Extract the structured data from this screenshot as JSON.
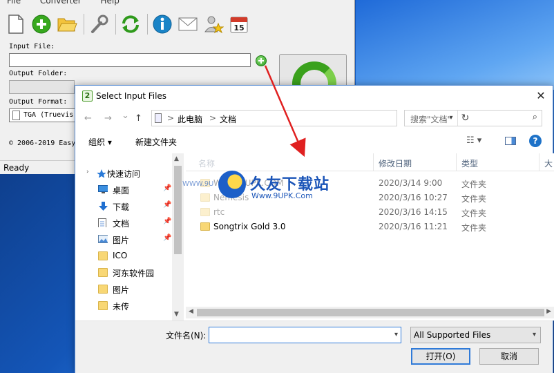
{
  "app": {
    "menu": [
      "File",
      "Converter",
      "Help"
    ],
    "labels": {
      "input_file": "Input File:",
      "output_folder": "Output Folder:",
      "output_format": "Output Format:"
    },
    "output_format_value": "TGA (Truevis",
    "copyright": "© 2006-2019 Easy",
    "status": "Ready",
    "toolbar_icons": [
      "new-file-icon",
      "add-icon",
      "open-folder-icon",
      "settings-wrench-icon",
      "convert-refresh-icon",
      "info-icon",
      "mail-icon",
      "user-star-icon",
      "calendar-icon"
    ],
    "calendar_day": "15"
  },
  "dialog": {
    "title": "Select Input Files",
    "title_icon_text": "2",
    "close": "✕",
    "nav": {
      "back": "←",
      "forward": "→",
      "dropdown": "⌄",
      "up": "↑"
    },
    "breadcrumbs": [
      "此电脑",
      "文档"
    ],
    "breadcrumb_sep": ">",
    "refresh": "↻",
    "search_placeholder": "搜索\"文档\"",
    "search_icon": "⌕",
    "commands": {
      "organize": "组织 ▾",
      "new_folder": "新建文件夹"
    },
    "view_icon": "☷ ▾",
    "help": "?",
    "nav_items": [
      {
        "label": "快速访问",
        "icon": "star-icon",
        "pinned": false
      },
      {
        "label": "桌面",
        "icon": "desktop-icon",
        "pinned": true
      },
      {
        "label": "下载",
        "icon": "download-icon",
        "pinned": true
      },
      {
        "label": "文档",
        "icon": "document-icon",
        "pinned": true
      },
      {
        "label": "图片",
        "icon": "picture-icon",
        "pinned": true
      },
      {
        "label": "ICO",
        "icon": "folder-icon",
        "pinned": false
      },
      {
        "label": "河东软件园",
        "icon": "folder-icon",
        "pinned": false
      },
      {
        "label": "图片",
        "icon": "folder-icon",
        "pinned": false
      },
      {
        "label": "未传",
        "icon": "folder-icon",
        "pinned": false
      }
    ],
    "columns": {
      "name": "名称",
      "date": "修改日期",
      "type": "类型",
      "size": "大"
    },
    "files": [
      {
        "name": "WWW.9UPK.COM",
        "date": "2020/3/14 9:00",
        "type": "文件夹",
        "faded": true
      },
      {
        "name": "Nemesis",
        "date": "2020/3/16 10:27",
        "type": "文件夹",
        "faded": true
      },
      {
        "name": "rtc",
        "date": "2020/3/16 14:15",
        "type": "文件夹",
        "faded": true
      },
      {
        "name": "Songtrix Gold 3.0",
        "date": "2020/3/16 11:21",
        "type": "文件夹",
        "faded": false
      }
    ],
    "watermark": {
      "title": "久友下载站",
      "url": "Www.9UPK.Com",
      "left_text": "WWW.9U"
    },
    "filename_label": "文件名(N):",
    "filename_value": "",
    "filter": "All Supported Files",
    "open_button": "打开(O)",
    "cancel_button": "取消"
  }
}
